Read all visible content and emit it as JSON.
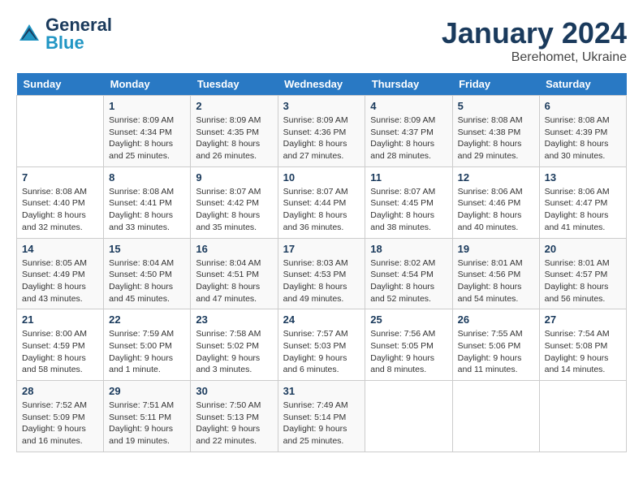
{
  "header": {
    "logo_line1": "General",
    "logo_line2": "Blue",
    "title": "January 2024",
    "subtitle": "Berehomet, Ukraine"
  },
  "calendar": {
    "days_of_week": [
      "Sunday",
      "Monday",
      "Tuesday",
      "Wednesday",
      "Thursday",
      "Friday",
      "Saturday"
    ],
    "weeks": [
      [
        {
          "number": "",
          "info": ""
        },
        {
          "number": "1",
          "info": "Sunrise: 8:09 AM\nSunset: 4:34 PM\nDaylight: 8 hours\nand 25 minutes."
        },
        {
          "number": "2",
          "info": "Sunrise: 8:09 AM\nSunset: 4:35 PM\nDaylight: 8 hours\nand 26 minutes."
        },
        {
          "number": "3",
          "info": "Sunrise: 8:09 AM\nSunset: 4:36 PM\nDaylight: 8 hours\nand 27 minutes."
        },
        {
          "number": "4",
          "info": "Sunrise: 8:09 AM\nSunset: 4:37 PM\nDaylight: 8 hours\nand 28 minutes."
        },
        {
          "number": "5",
          "info": "Sunrise: 8:08 AM\nSunset: 4:38 PM\nDaylight: 8 hours\nand 29 minutes."
        },
        {
          "number": "6",
          "info": "Sunrise: 8:08 AM\nSunset: 4:39 PM\nDaylight: 8 hours\nand 30 minutes."
        }
      ],
      [
        {
          "number": "7",
          "info": "Sunrise: 8:08 AM\nSunset: 4:40 PM\nDaylight: 8 hours\nand 32 minutes."
        },
        {
          "number": "8",
          "info": "Sunrise: 8:08 AM\nSunset: 4:41 PM\nDaylight: 8 hours\nand 33 minutes."
        },
        {
          "number": "9",
          "info": "Sunrise: 8:07 AM\nSunset: 4:42 PM\nDaylight: 8 hours\nand 35 minutes."
        },
        {
          "number": "10",
          "info": "Sunrise: 8:07 AM\nSunset: 4:44 PM\nDaylight: 8 hours\nand 36 minutes."
        },
        {
          "number": "11",
          "info": "Sunrise: 8:07 AM\nSunset: 4:45 PM\nDaylight: 8 hours\nand 38 minutes."
        },
        {
          "number": "12",
          "info": "Sunrise: 8:06 AM\nSunset: 4:46 PM\nDaylight: 8 hours\nand 40 minutes."
        },
        {
          "number": "13",
          "info": "Sunrise: 8:06 AM\nSunset: 4:47 PM\nDaylight: 8 hours\nand 41 minutes."
        }
      ],
      [
        {
          "number": "14",
          "info": "Sunrise: 8:05 AM\nSunset: 4:49 PM\nDaylight: 8 hours\nand 43 minutes."
        },
        {
          "number": "15",
          "info": "Sunrise: 8:04 AM\nSunset: 4:50 PM\nDaylight: 8 hours\nand 45 minutes."
        },
        {
          "number": "16",
          "info": "Sunrise: 8:04 AM\nSunset: 4:51 PM\nDaylight: 8 hours\nand 47 minutes."
        },
        {
          "number": "17",
          "info": "Sunrise: 8:03 AM\nSunset: 4:53 PM\nDaylight: 8 hours\nand 49 minutes."
        },
        {
          "number": "18",
          "info": "Sunrise: 8:02 AM\nSunset: 4:54 PM\nDaylight: 8 hours\nand 52 minutes."
        },
        {
          "number": "19",
          "info": "Sunrise: 8:01 AM\nSunset: 4:56 PM\nDaylight: 8 hours\nand 54 minutes."
        },
        {
          "number": "20",
          "info": "Sunrise: 8:01 AM\nSunset: 4:57 PM\nDaylight: 8 hours\nand 56 minutes."
        }
      ],
      [
        {
          "number": "21",
          "info": "Sunrise: 8:00 AM\nSunset: 4:59 PM\nDaylight: 8 hours\nand 58 minutes."
        },
        {
          "number": "22",
          "info": "Sunrise: 7:59 AM\nSunset: 5:00 PM\nDaylight: 9 hours\nand 1 minute."
        },
        {
          "number": "23",
          "info": "Sunrise: 7:58 AM\nSunset: 5:02 PM\nDaylight: 9 hours\nand 3 minutes."
        },
        {
          "number": "24",
          "info": "Sunrise: 7:57 AM\nSunset: 5:03 PM\nDaylight: 9 hours\nand 6 minutes."
        },
        {
          "number": "25",
          "info": "Sunrise: 7:56 AM\nSunset: 5:05 PM\nDaylight: 9 hours\nand 8 minutes."
        },
        {
          "number": "26",
          "info": "Sunrise: 7:55 AM\nSunset: 5:06 PM\nDaylight: 9 hours\nand 11 minutes."
        },
        {
          "number": "27",
          "info": "Sunrise: 7:54 AM\nSunset: 5:08 PM\nDaylight: 9 hours\nand 14 minutes."
        }
      ],
      [
        {
          "number": "28",
          "info": "Sunrise: 7:52 AM\nSunset: 5:09 PM\nDaylight: 9 hours\nand 16 minutes."
        },
        {
          "number": "29",
          "info": "Sunrise: 7:51 AM\nSunset: 5:11 PM\nDaylight: 9 hours\nand 19 minutes."
        },
        {
          "number": "30",
          "info": "Sunrise: 7:50 AM\nSunset: 5:13 PM\nDaylight: 9 hours\nand 22 minutes."
        },
        {
          "number": "31",
          "info": "Sunrise: 7:49 AM\nSunset: 5:14 PM\nDaylight: 9 hours\nand 25 minutes."
        },
        {
          "number": "",
          "info": ""
        },
        {
          "number": "",
          "info": ""
        },
        {
          "number": "",
          "info": ""
        }
      ]
    ]
  }
}
